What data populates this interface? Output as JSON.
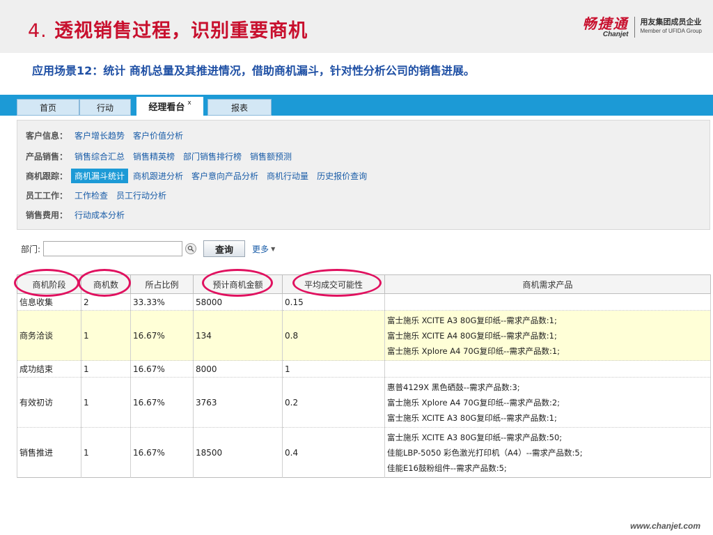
{
  "slide": {
    "title_num": "4.",
    "title_text": "透视销售过程，识别重要商机",
    "subtitle": "应用场景12：统计 商机总量及其推进情况，借助商机漏斗，针对性分析公司的销售进展。",
    "footer": "www.chanjet.com"
  },
  "logo": {
    "cn": "畅捷通",
    "en": "Chanjet",
    "sub_cn": "用友集团成员企业",
    "sub_en": "Member of UFIDA Group"
  },
  "tabs": [
    {
      "label": "首页"
    },
    {
      "label": "行动"
    },
    {
      "label": "经理看台",
      "close": "x"
    },
    {
      "label": "报表"
    }
  ],
  "menu": [
    {
      "category": "客户信息：",
      "links": [
        "客户增长趋势",
        "客户价值分析"
      ]
    },
    {
      "category": "产品销售：",
      "links": [
        "销售综合汇总",
        "销售精英榜",
        "部门销售排行榜",
        "销售额预测"
      ]
    },
    {
      "category": "商机跟踪：",
      "links": [
        "商机漏斗统计",
        "商机跟进分析",
        "客户意向产品分析",
        "商机行动量",
        "历史报价查询"
      ]
    },
    {
      "category": "员工工作：",
      "links": [
        "工作检查",
        "员工行动分析"
      ]
    },
    {
      "category": "销售费用：",
      "links": [
        "行动成本分析"
      ]
    }
  ],
  "filter": {
    "label": "部门:",
    "dept_value": "",
    "query_label": "查询",
    "more_label": "更多"
  },
  "table": {
    "headers": [
      "商机阶段",
      "商机数",
      "所占比例",
      "预计商机金额",
      "平均成交可能性",
      "商机需求产品"
    ],
    "rows": [
      {
        "stage": "信息收集",
        "count": "2",
        "ratio": "33.33%",
        "amount": "58000",
        "prob": "0.15",
        "products": []
      },
      {
        "stage": "商务洽谈",
        "count": "1",
        "ratio": "16.67%",
        "amount": "134",
        "prob": "0.8",
        "products": [
          "富士施乐 XCITE A3 80G复印纸--需求产品数:1;",
          "富士施乐 XCITE A4 80G复印纸--需求产品数:1;",
          "富士施乐 Xplore A4 70G复印纸--需求产品数:1;"
        ]
      },
      {
        "stage": "成功结束",
        "count": "1",
        "ratio": "16.67%",
        "amount": "8000",
        "prob": "1",
        "products": []
      },
      {
        "stage": "有效初访",
        "count": "1",
        "ratio": "16.67%",
        "amount": "3763",
        "prob": "0.2",
        "products": [
          "惠普4129X 黑色硒鼓--需求产品数:3;",
          "富士施乐 Xplore A4 70G复印纸--需求产品数:2;",
          "富士施乐 XCITE A3 80G复印纸--需求产品数:1;"
        ]
      },
      {
        "stage": "销售推进",
        "count": "1",
        "ratio": "16.67%",
        "amount": "18500",
        "prob": "0.4",
        "products": [
          "富士施乐 XCITE A3 80G复印纸--需求产品数:50;",
          "佳能LBP-5050 彩色激光打印机（A4）--需求产品数:5;",
          "佳能E16鼓粉组件--需求产品数:5;"
        ]
      }
    ]
  },
  "colors": {
    "title_red": "#c8102e",
    "subtitle_blue": "#1e4fa4",
    "tabbar_blue": "#1c9ad6",
    "annotation_pink": "#e0115f",
    "highlight_row": "#ffffd7"
  }
}
